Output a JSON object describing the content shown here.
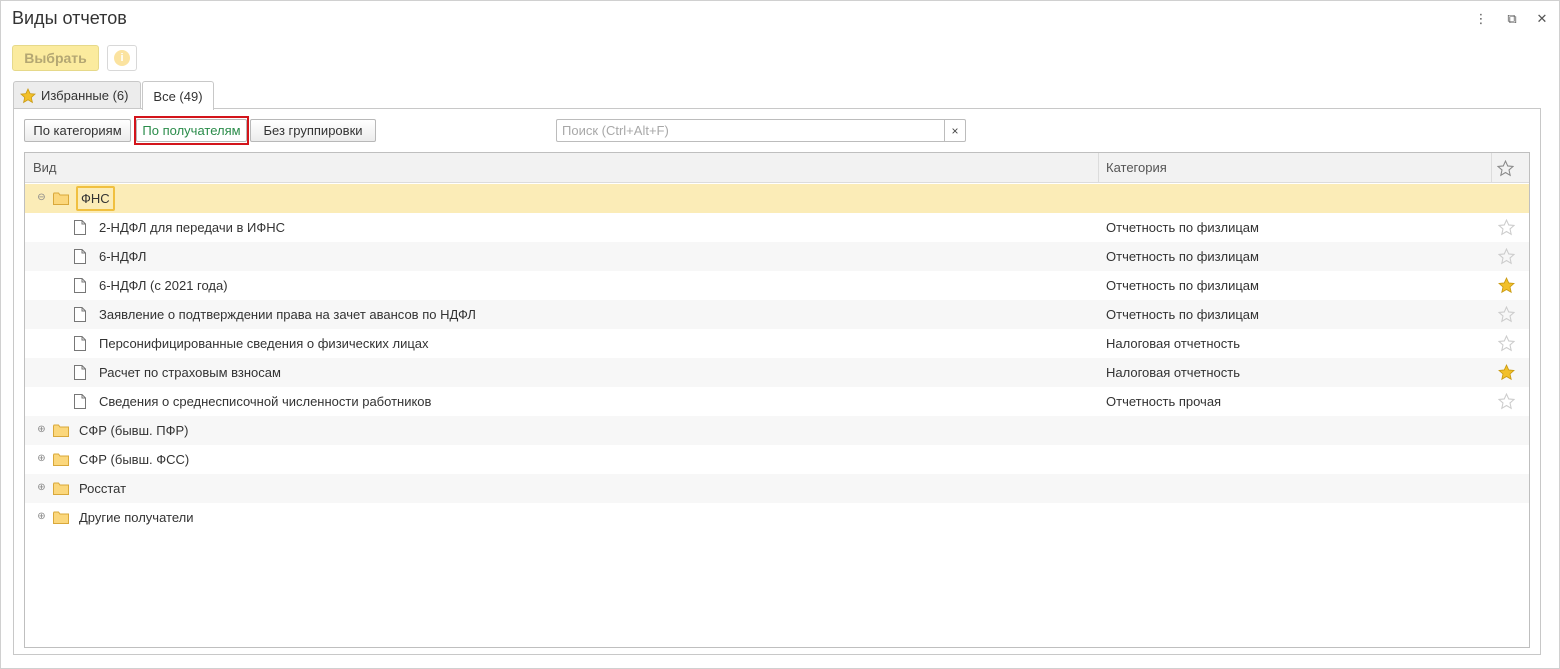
{
  "window": {
    "title": "Виды отчетов",
    "controls": {
      "menu": "⋮",
      "restore": "⧉",
      "close": "✕"
    }
  },
  "toolbar": {
    "select_label": "Выбрать",
    "info_icon": "i"
  },
  "tabs": [
    {
      "label": "Избранные (6)",
      "icon": "star-icon",
      "active": false
    },
    {
      "label": "Все (49)",
      "active": true
    }
  ],
  "grouping": {
    "by_category": "По категориям",
    "by_recipient": "По получателям",
    "no_grouping": "Без группировки",
    "active": "by_recipient"
  },
  "search": {
    "placeholder": "Поиск (Ctrl+Alt+F)",
    "value": "",
    "clear": "×"
  },
  "table": {
    "columns": {
      "kind": "Вид",
      "category": "Категория"
    },
    "groups": [
      {
        "name": "ФНС",
        "expanded": true,
        "selected": true,
        "items": [
          {
            "name": "2-НДФЛ для передачи в ИФНС",
            "category": "Отчетность по физлицам",
            "favorite": false
          },
          {
            "name": "6-НДФЛ",
            "category": "Отчетность по физлицам",
            "favorite": false
          },
          {
            "name": "6-НДФЛ (с 2021 года)",
            "category": "Отчетность по физлицам",
            "favorite": true
          },
          {
            "name": "Заявление о подтверждении права на зачет авансов по НДФЛ",
            "category": "Отчетность по физлицам",
            "favorite": false
          },
          {
            "name": "Персонифицированные сведения о физических лицах",
            "category": "Налоговая отчетность",
            "favorite": false
          },
          {
            "name": "Расчет по страховым взносам",
            "category": "Налоговая отчетность",
            "favorite": true
          },
          {
            "name": "Сведения о среднесписочной численности работников",
            "category": "Отчетность прочая",
            "favorite": false
          }
        ]
      },
      {
        "name": "СФР (бывш. ПФР)",
        "expanded": false
      },
      {
        "name": "СФР (бывш. ФСС)",
        "expanded": false
      },
      {
        "name": "Росстат",
        "expanded": false
      },
      {
        "name": "Другие получатели",
        "expanded": false
      }
    ]
  },
  "colors": {
    "accent_yellow": "#fbeb9e",
    "selected_row": "#fbecb7",
    "active_group_text": "#2a8c4a",
    "highlight_border": "#d3141b",
    "star_filled": "#f2c029",
    "star_empty": "#cccccc"
  }
}
